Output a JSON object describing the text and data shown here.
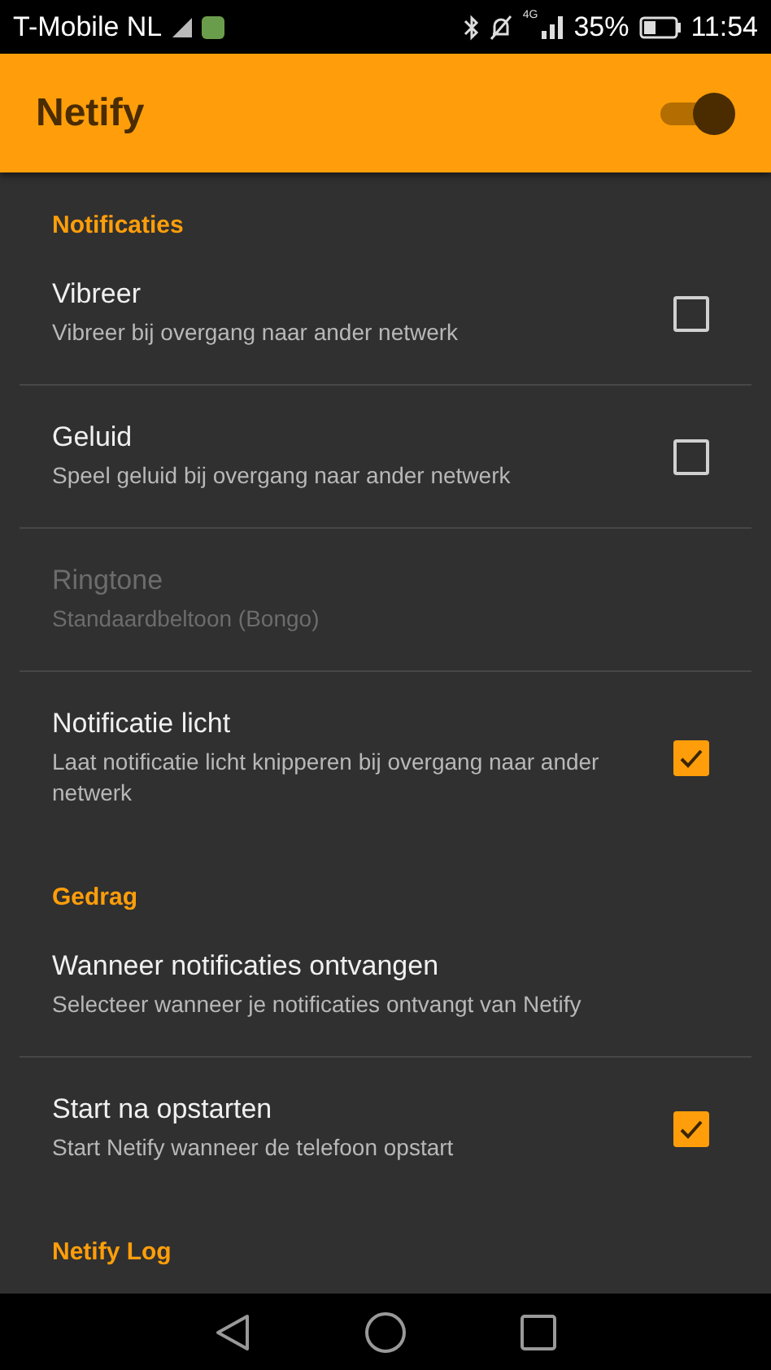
{
  "status_bar": {
    "carrier": "T-Mobile  NL",
    "network": "4G",
    "battery": "35%",
    "time": "11:54"
  },
  "app_bar": {
    "title": "Netify",
    "switch_on": true
  },
  "sections": [
    {
      "title": "Notificaties",
      "items": [
        {
          "kind": "checkbox",
          "title": "Vibreer",
          "summary": "Vibreer bij overgang naar ander netwerk",
          "disabled": false,
          "checked": false
        },
        {
          "kind": "checkbox",
          "title": "Geluid",
          "summary": "Speel geluid bij overgang naar ander netwerk",
          "disabled": false,
          "checked": false
        },
        {
          "kind": "plain",
          "title": "Ringtone",
          "summary": "Standaardbeltoon (Bongo)",
          "disabled": true
        },
        {
          "kind": "checkbox",
          "title": "Notificatie licht",
          "summary": "Laat notificatie licht knipperen bij overgang naar ander netwerk",
          "disabled": false,
          "checked": true
        }
      ]
    },
    {
      "title": "Gedrag",
      "items": [
        {
          "kind": "plain",
          "title": "Wanneer notificaties ontvangen",
          "summary": "Selecteer wanneer je notificaties ontvangt van Netify",
          "disabled": false
        },
        {
          "kind": "checkbox",
          "title": "Start na opstarten",
          "summary": "Start Netify wanneer de telefoon opstart",
          "disabled": false,
          "checked": true
        }
      ]
    },
    {
      "title": "Netify Log"
    }
  ]
}
